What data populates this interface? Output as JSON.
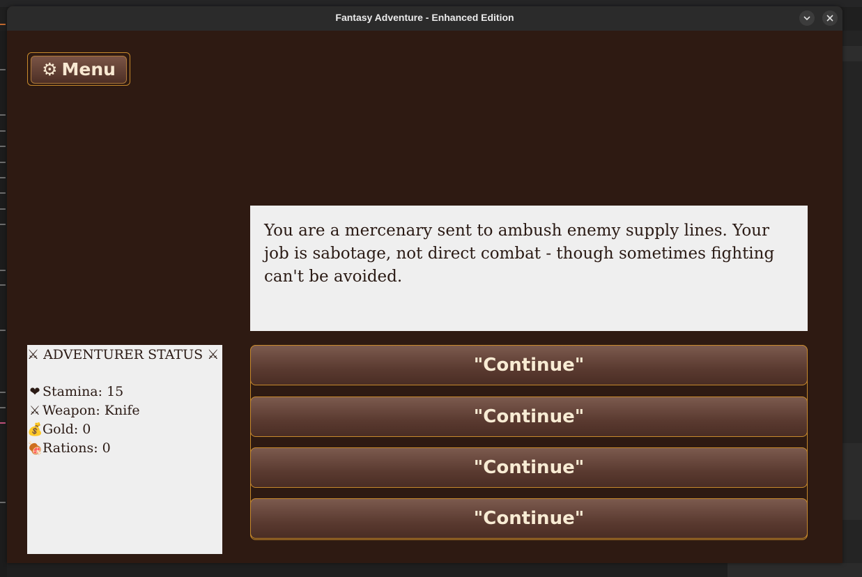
{
  "window": {
    "title": "Fantasy Adventure - Enhanced Edition"
  },
  "menu": {
    "icon": "⚙",
    "label": "Menu"
  },
  "story": {
    "text": "You are a mercenary sent to ambush enemy supply lines. Your job is sabotage, not direct combat - though sometimes fighting can't be avoided."
  },
  "status": {
    "title": "⚔ ADVENTURER STATUS ⚔",
    "stamina_icon": "❤",
    "stamina": "Stamina: 15",
    "weapon_icon": "⚔",
    "weapon": "Weapon: Knife",
    "gold_icon": "💰",
    "gold": "Gold: 0",
    "rations_icon": "🍖",
    "rations": "Rations: 0"
  },
  "choices": [
    {
      "label": "\"Continue\""
    },
    {
      "label": "\"Continue\""
    },
    {
      "label": "\"Continue\""
    },
    {
      "label": "\"Continue\""
    }
  ],
  "colors": {
    "background": "#2e1a12",
    "accent_border": "#c88a2c",
    "button_text": "#f8ecd4",
    "panel_bg": "#efefef"
  }
}
